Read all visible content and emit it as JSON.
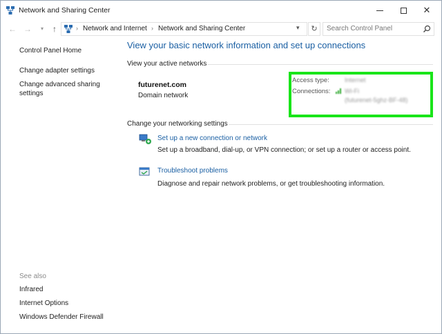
{
  "window": {
    "title": "Network and Sharing Center"
  },
  "address": {
    "crumbs": [
      "Network and Internet",
      "Network and Sharing Center"
    ],
    "search_placeholder": "Search Control Panel"
  },
  "sidebar": {
    "items": [
      {
        "label": "Control Panel Home"
      },
      {
        "label": "Change adapter settings"
      },
      {
        "label": "Change advanced sharing"
      },
      {
        "label": "settings"
      }
    ],
    "see_also_label": "See also",
    "see_also": [
      {
        "label": "Infrared"
      },
      {
        "label": "Internet Options"
      },
      {
        "label": "Windows Defender Firewall"
      }
    ]
  },
  "main": {
    "title": "View your basic network information and set up connections",
    "active_networks_heading": "View your active networks",
    "network": {
      "name": "futurenet.com",
      "type": "Domain network",
      "access_type_label": "Access type:",
      "access_type_value": "Internet",
      "connections_label": "Connections:",
      "connections_value_line1": "Wi-Fi",
      "connections_value_line2": "(futurenet-5ghz-BF-48)"
    },
    "change_settings_heading": "Change your networking settings",
    "tasks": [
      {
        "link": "Set up a new connection or network",
        "desc": "Set up a broadband, dial-up, or VPN connection; or set up a router or access point."
      },
      {
        "link": "Troubleshoot problems",
        "desc": "Diagnose and repair network problems, or get troubleshooting information."
      }
    ]
  },
  "colors": {
    "link": "#1a5fa3",
    "highlight": "#19e519"
  }
}
